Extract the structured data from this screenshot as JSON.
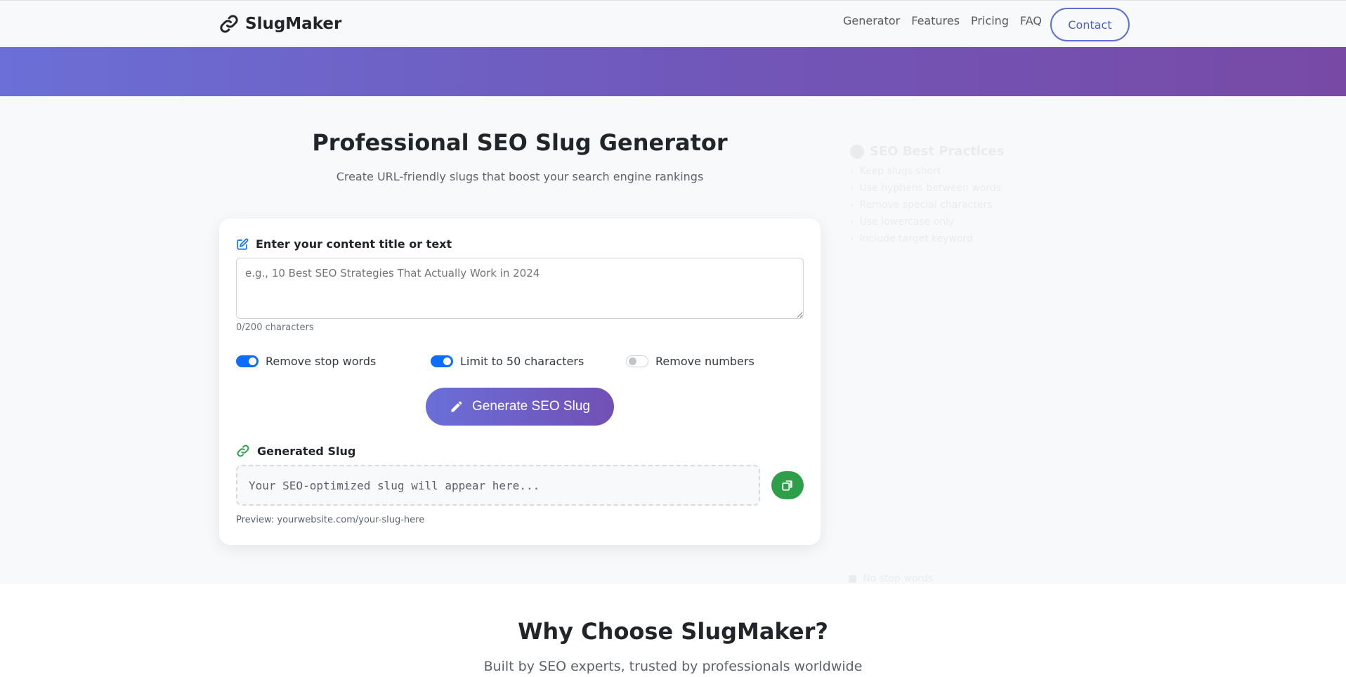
{
  "navbar": {
    "brand": "SlugMaker",
    "links": [
      "Generator",
      "Features",
      "Pricing",
      "FAQ"
    ],
    "contact_label": "Contact"
  },
  "hero": {
    "title": "Professional SEO Slug Generator",
    "subtitle": "Create URL-friendly slugs that boost your search engine rankings"
  },
  "form": {
    "input_label": "Enter your content title or text",
    "input_value": "",
    "input_placeholder": "e.g., 10 Best SEO Strategies That Actually Work in 2024",
    "char_count": "0/200 characters",
    "options": [
      {
        "label": "Remove stop words",
        "enabled": true
      },
      {
        "label": "Limit to 50 characters",
        "enabled": true
      },
      {
        "label": "Remove numbers",
        "enabled": false
      }
    ],
    "generate_label": "Generate SEO Slug",
    "output_label": "Generated Slug",
    "output_placeholder": "Your SEO-optimized slug will appear here...",
    "preview": "Preview: yourwebsite.com/your-slug-here"
  },
  "sidebar": {
    "title": "SEO Best Practices",
    "items": [
      "Keep slugs short",
      "Use hyphens between words",
      "Remove special characters",
      "Use lowercase only",
      "Include target keyword"
    ],
    "bottom_note": "No stop words"
  },
  "why": {
    "title": "Why Choose SlugMaker?",
    "subtitle": "Built by SEO experts, trusted by professionals worldwide"
  },
  "colors": {
    "primary": "#0d6efd",
    "gradient_start": "#6a6fd8",
    "gradient_end": "#7250b4",
    "copy_button": "#2e9e4b",
    "contact_border": "#5b6fd6"
  }
}
